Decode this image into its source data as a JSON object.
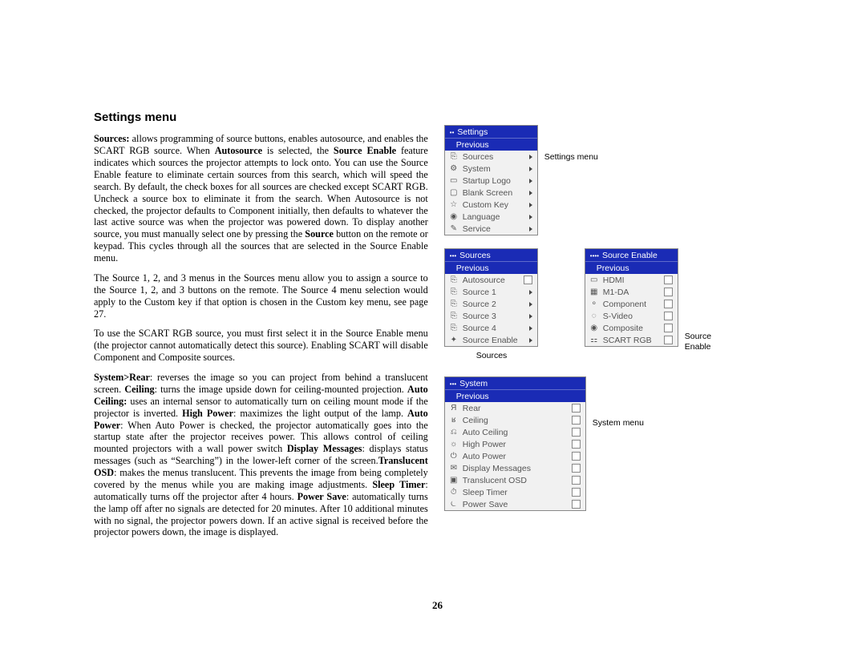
{
  "heading": "Settings menu",
  "paragraphs": {
    "p1_parts": [
      {
        "bold": true,
        "text": "Sources:"
      },
      {
        "text": " allows programming of source buttons, enables autosource, and enables the SCART RGB source. When "
      },
      {
        "bold": true,
        "text": "Autosource"
      },
      {
        "text": " is selected, the "
      },
      {
        "bold": true,
        "text": "Source Enable"
      },
      {
        "text": " feature indicates which sources the projector attempts to lock onto. You can use the Source Enable feature to eliminate certain sources from this search, which will speed the search. By default, the check boxes for all sources are checked except SCART RGB. Uncheck a source box to eliminate it from the search. When Autosource is not checked, the projector defaults to Component initially, then defaults to whatever the last active source was when the projector was powered down. To display another source, you must manually select one by pressing the "
      },
      {
        "bold": true,
        "text": "Source"
      },
      {
        "text": " button on the remote or keypad. This cycles through all the sources that are selected in the Source Enable menu."
      }
    ],
    "p2": "The Source 1, 2, and 3 menus in the Sources menu allow you to assign a source to the Source 1, 2, and 3 buttons on the remote. The Source 4 menu selection would apply to the Custom key if that option is chosen in the Custom key menu, see page 27.",
    "p3": "To use the SCART RGB source, you must first select it in the Source Enable menu (the projector cannot automatically detect this source). Enabling SCART will disable Component and Composite sources.",
    "p4_parts": [
      {
        "bold": true,
        "text": "System>Rear"
      },
      {
        "text": ": reverses the image so you can project from behind a translucent screen. "
      },
      {
        "bold": true,
        "text": "Ceiling"
      },
      {
        "text": ": turns the image upside down for ceiling-mounted projection. "
      },
      {
        "bold": true,
        "text": "Auto Ceiling:"
      },
      {
        "text": " uses an internal sensor to automatically turn on ceiling mount mode if the projector is inverted. "
      },
      {
        "bold": true,
        "text": "High Power"
      },
      {
        "text": ": maximizes the light output of the lamp. "
      },
      {
        "bold": true,
        "text": "Auto Power"
      },
      {
        "text": ": When Auto Power is checked, the projector automatically goes into the startup state after the projector receives power. This allows control of ceiling mounted projectors with a wall power switch "
      },
      {
        "bold": true,
        "text": "Display Messages"
      },
      {
        "text": ": displays status messages (such as “Searching”) in the lower-left corner of the screen."
      },
      {
        "bold": true,
        "text": "Translucent OSD"
      },
      {
        "text": ": makes the menus translucent. This prevents the image from being completely covered by the menus while you are making image adjustments. "
      },
      {
        "bold": true,
        "text": "Sleep Timer"
      },
      {
        "text": ": automatically turns off the projector after 4 hours. "
      },
      {
        "bold": true,
        "text": "Power Save"
      },
      {
        "text": ": automatically turns the lamp off after no signals are detected for 20 minutes. After 10 additional minutes with no signal, the projector powers down. If an active signal is received before the projector powers down, the image is displayed."
      }
    ]
  },
  "page_number": "26",
  "fig_labels": {
    "settings": "Settings menu",
    "sources": "Sources",
    "source_enable1": "Source",
    "source_enable2": "Enable",
    "system": "System menu"
  },
  "menus": {
    "settings": {
      "title": "Settings",
      "previous": "Previous",
      "rows": [
        {
          "icon": "⎘",
          "label": "Sources",
          "arrow": true
        },
        {
          "icon": "⚙",
          "label": "System",
          "arrow": true
        },
        {
          "icon": "▭",
          "label": "Startup Logo",
          "arrow": true
        },
        {
          "icon": "▢",
          "label": "Blank Screen",
          "arrow": true
        },
        {
          "icon": "☆",
          "label": "Custom Key",
          "arrow": true
        },
        {
          "icon": "◉",
          "label": "Language",
          "arrow": true
        },
        {
          "icon": "✎",
          "label": "Service",
          "arrow": true
        }
      ]
    },
    "sources": {
      "title": "Sources",
      "previous": "Previous",
      "rows": [
        {
          "icon": "⎘",
          "label": "Autosource",
          "check": true
        },
        {
          "icon": "⎘",
          "label": "Source 1",
          "arrow": true
        },
        {
          "icon": "⎘",
          "label": "Source 2",
          "arrow": true
        },
        {
          "icon": "⎘",
          "label": "Source 3",
          "arrow": true
        },
        {
          "icon": "⎘",
          "label": "Source 4",
          "arrow": true
        },
        {
          "icon": "✦",
          "label": "Source Enable",
          "arrow": true
        }
      ]
    },
    "source_enable": {
      "title": "Source Enable",
      "previous": "Previous",
      "rows": [
        {
          "icon": "▭",
          "label": "HDMI",
          "check": true
        },
        {
          "icon": "▦",
          "label": "M1-DA",
          "check": true
        },
        {
          "icon": "⚬",
          "label": "Component",
          "check": true
        },
        {
          "icon": "◌",
          "label": "S-Video",
          "check": true
        },
        {
          "icon": "◉",
          "label": "Composite",
          "check": true
        },
        {
          "icon": "⚏",
          "label": "SCART RGB",
          "check": true
        }
      ]
    },
    "system": {
      "title": "System",
      "previous": "Previous",
      "rows": [
        {
          "icon": "Я",
          "label": "Rear",
          "check": true
        },
        {
          "icon": "ʁ",
          "label": "Ceiling",
          "check": true
        },
        {
          "icon": "⎌",
          "label": "Auto Ceiling",
          "check": true
        },
        {
          "icon": "☼",
          "label": "High Power",
          "check": true
        },
        {
          "icon": "⏻",
          "label": "Auto Power",
          "check": true
        },
        {
          "icon": "✉",
          "label": "Display Messages",
          "check": true
        },
        {
          "icon": "▣",
          "label": "Translucent OSD",
          "check": true
        },
        {
          "icon": "⏱",
          "label": "Sleep Timer",
          "check": true
        },
        {
          "icon": "⏾",
          "label": "Power Save",
          "check": true
        }
      ]
    }
  }
}
